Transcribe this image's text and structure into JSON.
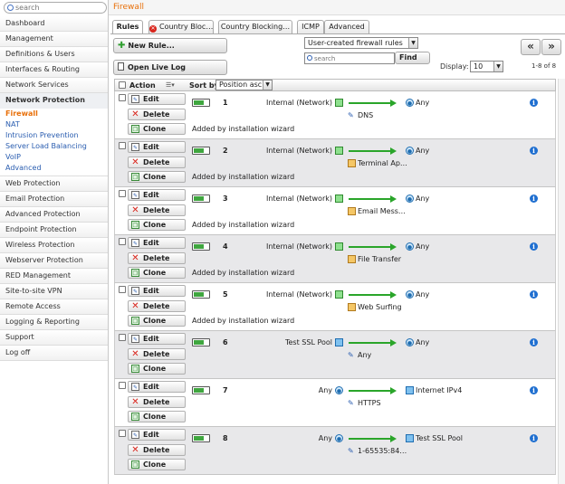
{
  "sidebar": {
    "search_placeholder": "search",
    "items_top": [
      "Dashboard",
      "Management",
      "Definitions & Users",
      "Interfaces & Routing",
      "Network Services"
    ],
    "active_section": "Network Protection",
    "sub_items": [
      "Firewall",
      "NAT",
      "Intrusion Prevention",
      "Server Load Balancing",
      "VoIP",
      "Advanced"
    ],
    "items_bottom": [
      "Web Protection",
      "Email Protection",
      "Advanced Protection",
      "Endpoint Protection",
      "Wireless Protection",
      "Webserver Protection",
      "RED Management",
      "Site-to-site VPN",
      "Remote Access",
      "Logging & Reporting",
      "Support",
      "Log off"
    ]
  },
  "header": {
    "title": "Firewall"
  },
  "tabs": [
    "Rules",
    "Country Bloc…",
    "Country Blocking…",
    "ICMP",
    "Advanced"
  ],
  "toolbar": {
    "new_rule": "New Rule...",
    "open_live_log": "Open Live Log",
    "filter_select": "User-created firewall rules",
    "search_placeholder": "search",
    "find": "Find",
    "display_label": "Display:",
    "display_value": "10",
    "page_info": "1-8 of 8",
    "first": "«",
    "prev": "»"
  },
  "table": {
    "action_header": "Action",
    "sortby_label": "Sort by:",
    "sortby_value": "Position asc",
    "buttons": {
      "edit": "Edit",
      "delete": "Delete",
      "clone": "Clone"
    },
    "rules": [
      {
        "num": "1",
        "source": "Internal (Network)",
        "service": "DNS",
        "destination": "Any",
        "comment": "Added by installation wizard"
      },
      {
        "num": "2",
        "source": "Internal (Network)",
        "service": "Terminal Ap…",
        "destination": "Any",
        "comment": "Added by installation wizard"
      },
      {
        "num": "3",
        "source": "Internal (Network)",
        "service": "Email Mess…",
        "destination": "Any",
        "comment": "Added by installation wizard"
      },
      {
        "num": "4",
        "source": "Internal (Network)",
        "service": "File Transfer",
        "destination": "Any",
        "comment": "Added by installation wizard"
      },
      {
        "num": "5",
        "source": "Internal (Network)",
        "service": "Web Surfing",
        "destination": "Any",
        "comment": "Added by installation wizard"
      },
      {
        "num": "6",
        "source": "Test SSL Pool",
        "service": "Any",
        "destination": "Any",
        "comment": ""
      },
      {
        "num": "7",
        "source": "Any",
        "service": "HTTPS",
        "destination": "Internet IPv4",
        "comment": ""
      },
      {
        "num": "8",
        "source": "Any",
        "service": "1-65535:84…",
        "destination": "Test SSL Pool",
        "comment": ""
      }
    ]
  }
}
